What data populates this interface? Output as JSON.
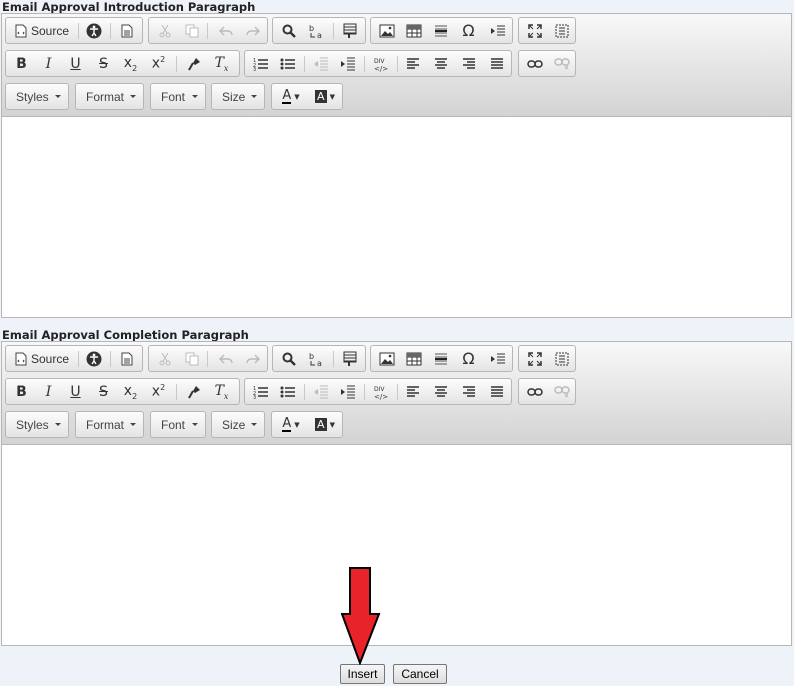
{
  "editors": [
    {
      "label": "Email Approval Introduction Paragraph",
      "source_label": "Source",
      "combos": [
        "Styles",
        "Format",
        "Font",
        "Size"
      ],
      "content": ""
    },
    {
      "label": "Email Approval Completion Paragraph",
      "source_label": "Source",
      "combos": [
        "Styles",
        "Format",
        "Font",
        "Size"
      ],
      "content": ""
    }
  ],
  "buttons": {
    "insert": "Insert",
    "cancel": "Cancel"
  },
  "glyphs": {
    "bold": "B",
    "italic": "I",
    "underline": "U",
    "strike": "S",
    "subscript": "x",
    "sub_mark": "2",
    "superscript": "x",
    "sup_mark": "2",
    "remove_format": "T",
    "remove_format_mark": "x",
    "omega": "Ω",
    "font_color": "A",
    "bg_color": "A",
    "div": "DIV"
  },
  "colors": {
    "arrow_fill": "#e8232a",
    "arrow_stroke": "#000000"
  }
}
